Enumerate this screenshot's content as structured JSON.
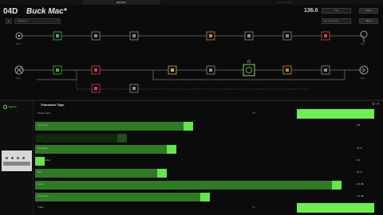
{
  "tabs": [
    {
      "label": "EDITOR",
      "active": true
    },
    {
      "label": "CONFIGURE",
      "active": false
    }
  ],
  "header": {
    "preset_number": "04D",
    "preset_name": "Buck Mac*",
    "setlist": "Factory 1",
    "tempo": "136.0",
    "tap_label": "Tap",
    "snapshot": "Set Snapshot",
    "save_label": "Save",
    "more_label": "More",
    "dock_glyph": "ⅱ"
  },
  "flow": {
    "path_a_input_label": "Multi",
    "path_b_input_label": "None",
    "path_a_output_label": "Multi",
    "path_b_output_label": "Main",
    "block_colors": {
      "green": "#46b04a",
      "gray": "#8a8a8a",
      "orange": "#d08a2a",
      "red": "#c8424a",
      "yellow": "#c8b43a",
      "selected": "#7fd65a",
      "wire": "#5a5a5a"
    },
    "icons": [
      "input-icon",
      "block-icon",
      "output-icon",
      "split-icon",
      "merge-icon"
    ]
  },
  "left_panel": {
    "bypass_label": "Bypass"
  },
  "model": {
    "title": "Transistor Tape",
    "icons": [
      "settings-icon",
      "close-icon"
    ]
  },
  "params": [
    {
      "name": "Tempo Sync",
      "type": "toggle",
      "center": "Off",
      "value": "",
      "level": 1.0,
      "dim": false
    },
    {
      "name": "Note Sync",
      "type": "slider",
      "value": "1/8",
      "level": 0.45,
      "dim": false
    },
    {
      "name": "Time",
      "type": "slider",
      "value": "",
      "level": 0.25,
      "dim": true
    },
    {
      "name": "Feedback",
      "type": "slider",
      "value": "40 %",
      "level": 0.4,
      "dim": false
    },
    {
      "name": "Wow/Flutter",
      "type": "slider",
      "value": "0.0",
      "level": 0.0,
      "dim": false
    },
    {
      "name": "Mix",
      "type": "slider",
      "value": "35 %",
      "level": 0.37,
      "dim": false
    },
    {
      "name": "Level",
      "type": "slider",
      "value": "0.0 dB",
      "level": 0.9,
      "dim": false
    },
    {
      "name": "Headroom",
      "type": "slider",
      "value": "0.0 dB",
      "level": 0.5,
      "dim": false
    },
    {
      "name": "Trails",
      "type": "toggle",
      "center": "On",
      "value": "",
      "level": 1.0,
      "dim": false
    }
  ]
}
